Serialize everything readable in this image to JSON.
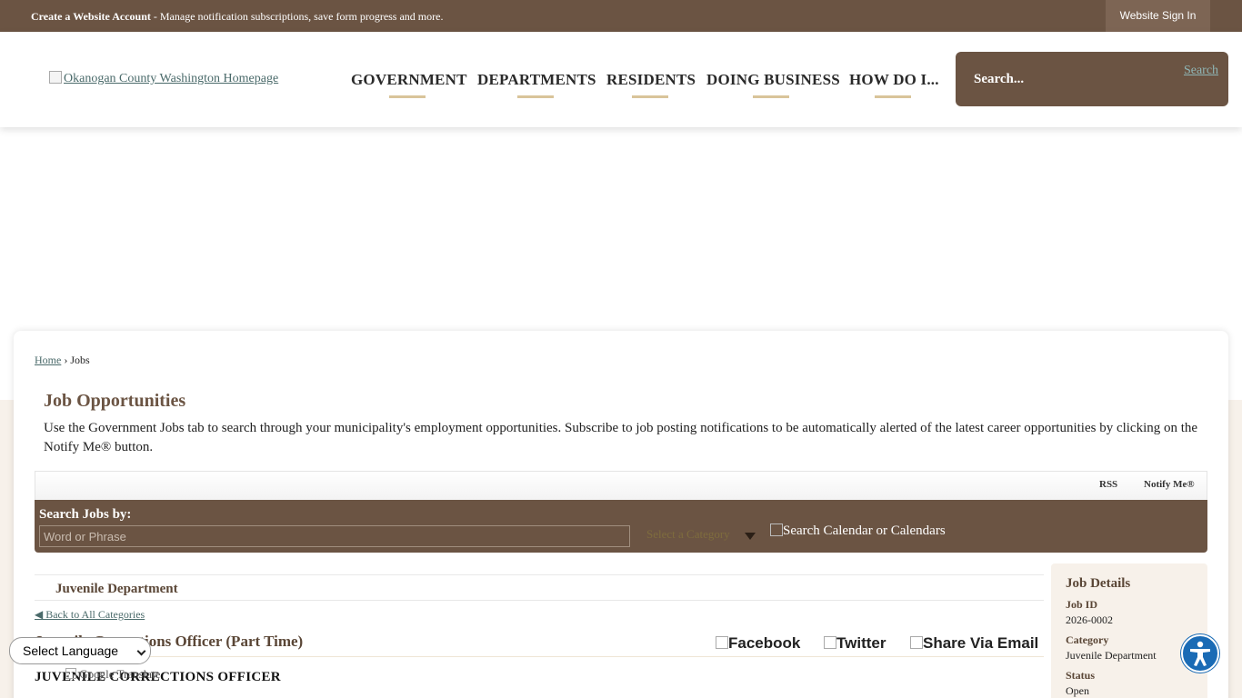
{
  "topbar": {
    "create_account": "Create a Website Account",
    "message": " - Manage notification subscriptions, save form progress and more.",
    "signin": "Website Sign In"
  },
  "header": {
    "logo_alt": "Okanogan County Washington Homepage",
    "nav": [
      "GOVERNMENT",
      "DEPARTMENTS",
      "RESIDENTS",
      "DOING BUSINESS",
      "HOW DO I..."
    ],
    "search_placeholder": "Search...",
    "search_button_alt": "Search"
  },
  "breadcrumb": {
    "home": "Home",
    "sep": " › ",
    "current": "Jobs"
  },
  "page": {
    "title": "Job Opportunities",
    "intro": "Use the Government Jobs tab to search through your municipality's employment opportunities. Subscribe to job posting notifications to be automatically alerted of the latest career opportunities by clicking on the Notify Me® button."
  },
  "toolbar": {
    "rss": "RSS",
    "notify": "Notify Me®"
  },
  "search_panel": {
    "label": "Search Jobs by:",
    "word_placeholder": "Word or Phrase",
    "category": "Select a Category",
    "calendar_btn_alt": "Search Calendar or Calendars"
  },
  "job": {
    "department": "Juvenile Department",
    "back": "◀ Back to All Categories",
    "title": "Juvenile Corrections Officer (Part Time)",
    "subhead": "JUVENILE CORRECTIONS OFFICER",
    "share": {
      "facebook": "Facebook",
      "twitter": "Twitter",
      "email": "Share Via Email"
    }
  },
  "details": {
    "title": "Job Details",
    "job_id_label": "Job ID",
    "job_id": "2026-0002",
    "category_label": "Category",
    "category": "Juvenile Department",
    "status_label": "Status",
    "status": "Open"
  },
  "translate": {
    "select_language": "Select Language",
    "powered": "Google Translate"
  },
  "colors": {
    "brand_brown": "#6b5443",
    "accent_tan": "#d9c49a",
    "beige": "#f7f1ea",
    "a11y_blue": "#1a6bb5"
  },
  "icons": {
    "accessibility": "accessibility-icon",
    "dropdown": "dropdown-arrow-icon"
  }
}
